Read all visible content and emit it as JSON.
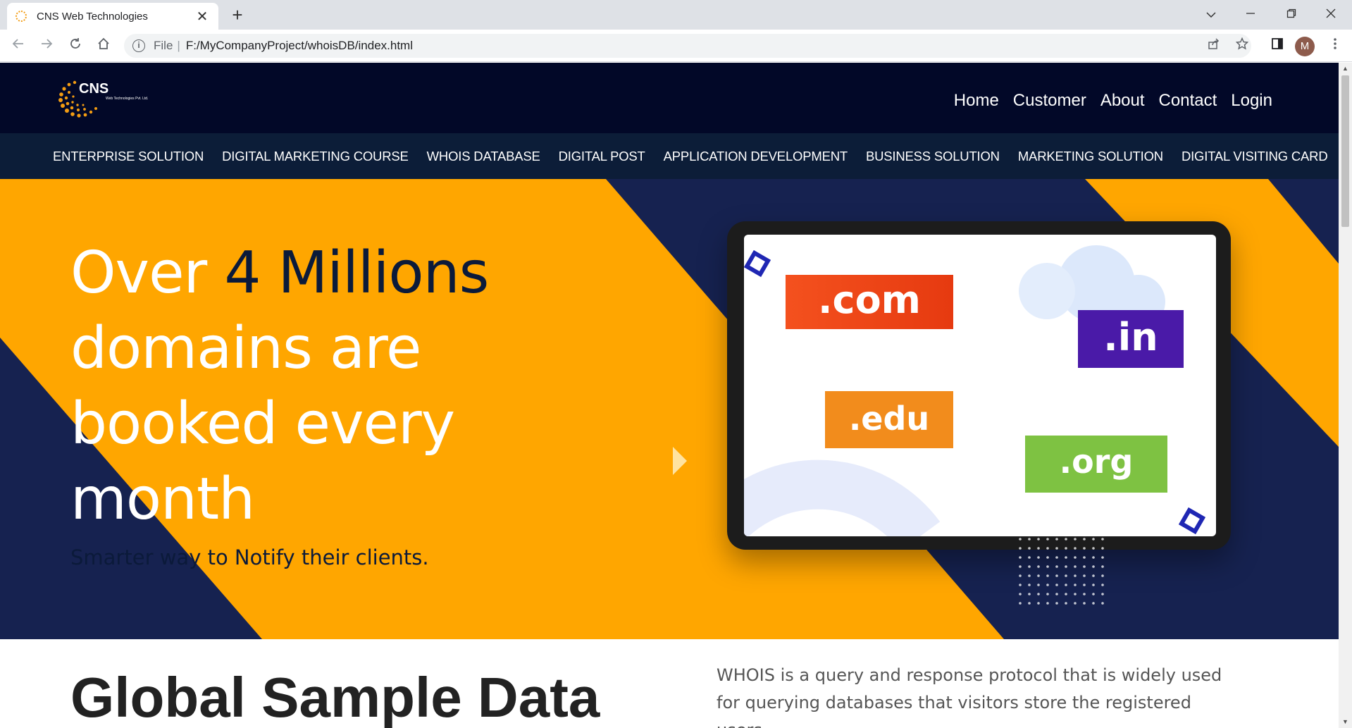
{
  "browser": {
    "tab_title": "CNS Web Technologies",
    "tab_close": "✕",
    "new_tab": "+",
    "url_scheme": "File",
    "url_separator": "|",
    "url_path": "F:/MyCompanyProject/whoisDB/index.html",
    "avatar_letter": "M",
    "favicon_text": "CNS"
  },
  "site": {
    "logo_text": "CNS",
    "logo_subtext": "Web Technologies Pvt. Ltd.",
    "top_nav": [
      "Home",
      "Customer",
      "About",
      "Contact",
      "Login"
    ],
    "sub_nav": [
      "ENTERPRISE SOLUTION",
      "DIGITAL MARKETING COURSE",
      "WHOIS DATABASE",
      "DIGITAL POST",
      "APPLICATION DEVELOPMENT",
      "BUSINESS SOLUTION",
      "MARKETING SOLUTION",
      "DIGITAL VISITING CARD"
    ]
  },
  "hero": {
    "title_part1": "Over ",
    "title_part2": "4 Millions",
    "title_part3": "domains are booked every month",
    "subtitle": "Smarter way to Notify their clients.",
    "domains": [
      ".com",
      ".in",
      ".edu",
      ".org"
    ]
  },
  "section": {
    "title": "Global Sample Data",
    "text": "WHOIS is a query and response protocol that is widely used for querying databases that visitors store the registered users"
  },
  "colors": {
    "accent_orange": "#ffa600",
    "navy": "#162250",
    "header_dark": "#020828",
    "subnav": "#0c1d38"
  }
}
